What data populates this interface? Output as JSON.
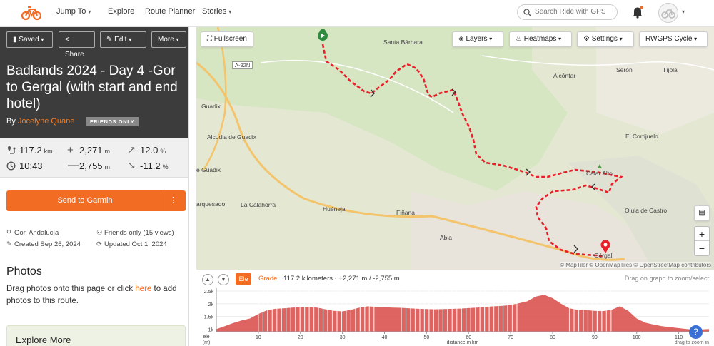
{
  "nav": {
    "items": [
      "Jump To",
      "Explore",
      "Route Planner",
      "Stories"
    ],
    "search_placeholder": "Search Ride with GPS",
    "brand_color": "#f26c23"
  },
  "route": {
    "buttons": {
      "saved": "Saved",
      "share": "Share",
      "edit": "Edit",
      "more": "More"
    },
    "title": "Badlands 2024 - Day 4 -Gor to Gergal (with start and end hotel)",
    "by_prefix": "By",
    "author": "Jocelyne Quane",
    "privacy_badge": "FRIENDS ONLY",
    "stats": {
      "distance": "117.2",
      "distance_unit": "km",
      "elevation_gain": "2,271",
      "gain_unit": "m",
      "max_grade": "12.0",
      "max_grade_unit": "%",
      "moving_time": "10:43",
      "elevation_loss": "2,755",
      "loss_unit": "m",
      "min_grade": "-11.2",
      "min_grade_unit": "%"
    },
    "send_to_garmin": "Send to Garmin",
    "more_options": "⋮",
    "location": "Gor, Andalucía",
    "visibility": "Friends only (15 views)",
    "created": "Created Sep 26, 2024",
    "updated": "Updated Oct 1, 2024",
    "photos_heading": "Photos",
    "photos_text_before": "Drag photos onto this page or click ",
    "photos_link": "here",
    "photos_text_after": " to add photos to this route.",
    "explore_more": "Explore More"
  },
  "map": {
    "fullscreen": "Fullscreen",
    "layers": "Layers",
    "heatmaps": "Heatmaps",
    "settings": "Settings",
    "basemap": "RWGPS Cycle",
    "route_color": "#e8202a",
    "labels": [
      "Santa Bárbara",
      "A-92N",
      "Alcóntar",
      "Serón",
      "Tíjola",
      "Guadix",
      "Alcudia de Guadix",
      "El Cortijuelo",
      "e Guadix",
      "Calar Alto",
      "arquesado",
      "La Calahorra",
      "Huéneja",
      "Fiñana",
      "Olula de Castro",
      "Abla",
      "Gérgal"
    ],
    "attribution": "© MapTiler © OpenMapTiles © OpenStreetMap contributors",
    "zoom_in": "+",
    "zoom_out": "−"
  },
  "elevation": {
    "ele_tab": "Ele",
    "grade_tab": "Grade",
    "summary": "117.2 kilometers · +2,271 m / -2,755 m",
    "hint": "Drag on graph to zoom/select",
    "y_ticks": [
      "2.5k",
      "2k",
      "1.5k",
      "1k"
    ],
    "y_label": "ele (m)",
    "x_ticks": [
      "10",
      "20",
      "30",
      "40",
      "50",
      "60",
      "70",
      "80",
      "90",
      "100",
      "110"
    ],
    "x_label": "distance in km",
    "zoom_hint": "drag to zoom in",
    "profile_km": [
      0,
      2,
      4,
      6,
      8,
      10,
      12,
      14,
      16,
      18,
      20,
      22,
      24,
      26,
      28,
      30,
      32,
      34,
      36,
      38,
      40,
      42,
      44,
      46,
      48,
      50,
      52,
      54,
      56,
      58,
      60,
      62,
      64,
      66,
      68,
      70,
      72,
      74,
      76,
      78,
      80,
      82,
      84,
      86,
      88,
      90,
      92,
      94,
      96,
      98,
      100,
      102,
      104,
      106,
      108,
      110,
      112,
      114,
      117.2
    ],
    "profile_m": [
      1000,
      1120,
      1240,
      1340,
      1420,
      1600,
      1740,
      1800,
      1820,
      1850,
      1860,
      1880,
      1850,
      1780,
      1720,
      1700,
      1760,
      1850,
      1900,
      1880,
      1860,
      1850,
      1840,
      1820,
      1800,
      1790,
      1780,
      1790,
      1800,
      1810,
      1830,
      1850,
      1880,
      1900,
      1920,
      1950,
      2020,
      2100,
      2280,
      2350,
      2220,
      2000,
      1820,
      1760,
      1750,
      1720,
      1710,
      1760,
      1900,
      1720,
      1420,
      1260,
      1180,
      1120,
      1080,
      1040,
      1000,
      980,
      1000
    ]
  }
}
